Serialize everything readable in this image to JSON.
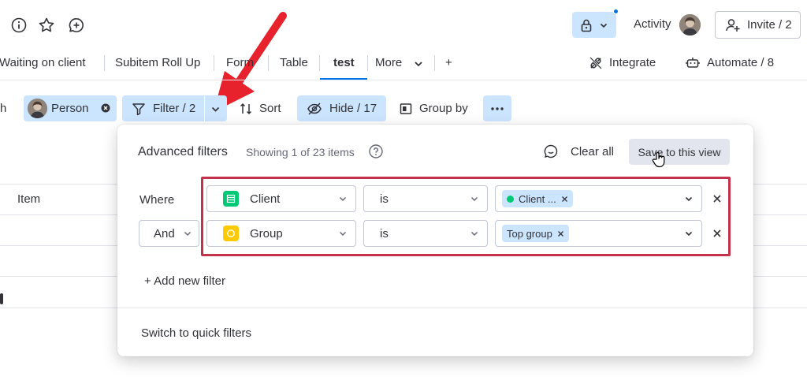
{
  "topbar": {
    "activity_label": "Activity",
    "invite_label": "Invite / 2"
  },
  "tabs": [
    {
      "label": "Waiting on client"
    },
    {
      "label": "Subitem Roll Up"
    },
    {
      "label": "Form"
    },
    {
      "label": "Table"
    },
    {
      "label": "test",
      "active": true
    },
    {
      "label": "More"
    },
    {
      "label": "+"
    }
  ],
  "tab_actions": {
    "integrate_label": "Integrate",
    "automate_label": "Automate / 8"
  },
  "toolbar": {
    "search_fragment": "h",
    "person_label": "Person",
    "filter_label": "Filter / 2",
    "sort_label": "Sort",
    "hide_label": "Hide / 17",
    "group_by_label": "Group by"
  },
  "board": {
    "item_column_header": "Item"
  },
  "advanced_filters": {
    "title": "Advanced filters",
    "showing": "Showing 1 of 23 items",
    "clear_all_label": "Clear all",
    "save_view_label": "Save to this view",
    "where_label": "Where",
    "conjunction": "And",
    "rules": [
      {
        "column": "Client",
        "column_color": "#00c875",
        "operator": "is",
        "value": "Client ...",
        "value_dot_color": "#00c875"
      },
      {
        "column": "Group",
        "column_color": "#ffcb00",
        "operator": "is",
        "value": "Top group"
      }
    ],
    "add_filter_label": "+ Add new filter",
    "switch_label": "Switch to quick filters"
  },
  "colors": {
    "accent": "#0073ea",
    "selected_bg": "#cce5ff",
    "highlight_red": "#c4314b",
    "arrow_red": "#e8222c"
  }
}
